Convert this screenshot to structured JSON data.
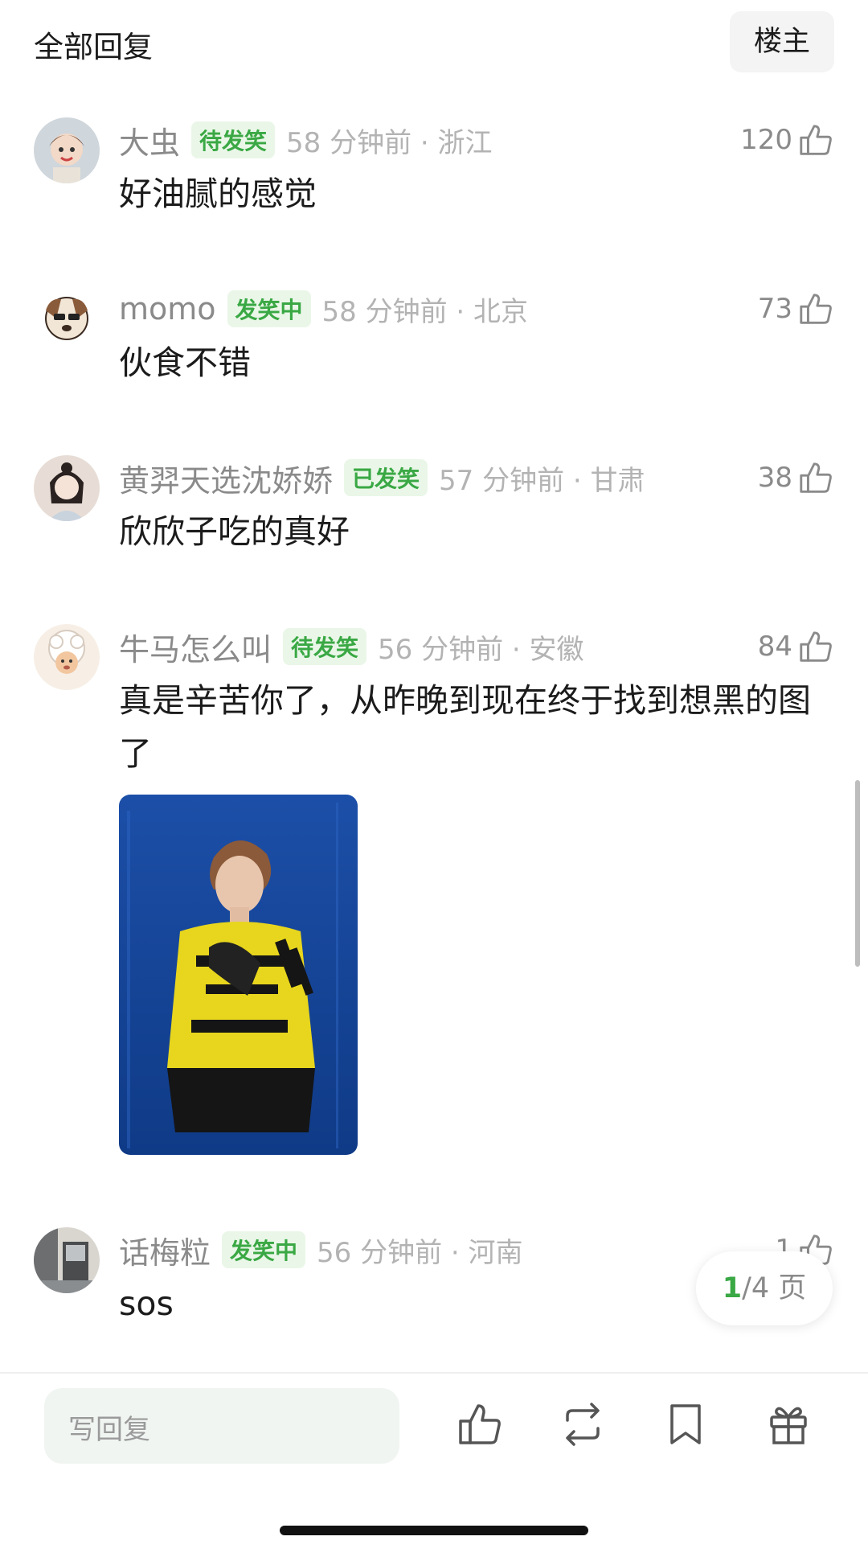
{
  "header": {
    "title": "全部回复",
    "owner_button": "楼主"
  },
  "comments": [
    {
      "username": "大虫",
      "badge": "待发笑",
      "time_location": "58 分钟前 · 浙江",
      "likes": "120",
      "text": "好油腻的感觉",
      "avatar_color": "#cfd6dc"
    },
    {
      "username": "momo",
      "badge": "发笑中",
      "time_location": "58 分钟前 · 北京",
      "likes": "73",
      "text": "伙食不错",
      "avatar_color": "#f2e6d6"
    },
    {
      "username": "黄羿天选沈娇娇",
      "badge": "已发笑",
      "time_location": "57 分钟前 · 甘肃",
      "likes": "38",
      "text": "欣欣子吃的真好",
      "avatar_color": "#e7ddd6"
    },
    {
      "username": "牛马怎么叫",
      "badge": "待发笑",
      "time_location": "56 分钟前 · 安徽",
      "likes": "84",
      "text": "真是辛苦你了，从昨晚到现在终于找到想黑的图了",
      "avatar_color": "#f7efe6"
    },
    {
      "username": "话梅粒",
      "badge": "发笑中",
      "time_location": "56 分钟前 · 河南",
      "likes": "1",
      "text": "sos",
      "avatar_color": "#8a8d90"
    }
  ],
  "pager": {
    "current": "1",
    "total_text": "/4 页"
  },
  "bottom_bar": {
    "reply_placeholder": "写回复"
  },
  "colors": {
    "accent_green": "#3aa844",
    "badge_bg": "#eaf7e8"
  }
}
